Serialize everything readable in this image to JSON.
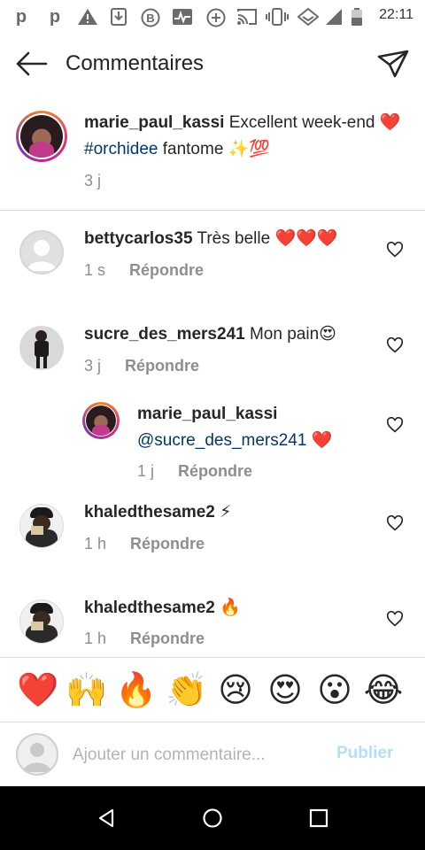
{
  "status_bar": {
    "time": "22:11",
    "icons": [
      "p-icon",
      "p-icon",
      "warning-icon",
      "download-icon",
      "b-circle-icon",
      "pulse-icon",
      "add-circle-icon",
      "cast-icon",
      "vibrate-icon",
      "data-saver-icon",
      "signal-icon",
      "battery-icon"
    ]
  },
  "header": {
    "title": "Commentaires"
  },
  "caption": {
    "username": "marie_paul_kassi",
    "text_before": " Excellent week-end ❤️ ",
    "hashtag": "#orchidee",
    "text_after": " fantome ✨💯",
    "time": "3 j"
  },
  "comments": [
    {
      "username": "bettycarlos35",
      "text": " Très belle ❤️❤️❤️",
      "time": "1 s",
      "reply_label": "Répondre"
    },
    {
      "username": "sucre_des_mers241",
      "text": " Mon pain😍",
      "time": "3 j",
      "reply_label": "Répondre"
    },
    {
      "username": "marie_paul_kassi",
      "mention": "@sucre_des_mers241",
      "text": " ❤️",
      "time": "1 j",
      "reply_label": "Répondre"
    },
    {
      "username": "khaledthesame2",
      "text": " ⚡",
      "time": "1 h",
      "reply_label": "Répondre"
    },
    {
      "username": "khaledthesame2",
      "text": " 🔥",
      "time": "1 h",
      "reply_label": "Répondre"
    }
  ],
  "emoji_bar": [
    "❤️",
    "🙌",
    "🔥",
    "👏",
    "😢",
    "😍",
    "😮",
    "😂"
  ],
  "composer": {
    "placeholder": "Ajouter un commentaire...",
    "publish_label": "Publier"
  },
  "colors": {
    "link": "#00376b",
    "muted": "#8e8e8e",
    "publish_disabled": "#b2dffc"
  }
}
